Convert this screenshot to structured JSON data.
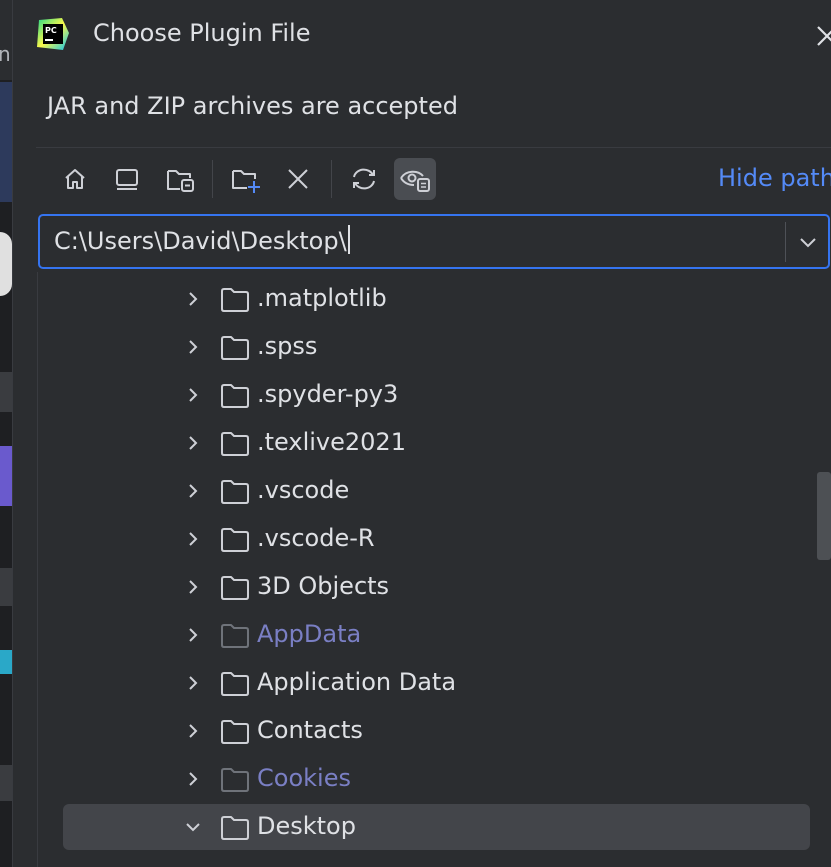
{
  "dialog": {
    "title": "Choose Plugin File",
    "description": "JAR and ZIP archives are accepted",
    "colors": {
      "background": "#2b2d30",
      "accent": "#3574f0",
      "link": "#548af7",
      "hidden_text": "#7a7fc4"
    }
  },
  "toolbar": {
    "buttons": [
      {
        "icon": "home-icon"
      },
      {
        "icon": "desktop-icon"
      },
      {
        "icon": "project-folder-icon"
      },
      {
        "icon": "new-folder-icon"
      },
      {
        "icon": "delete-icon"
      },
      {
        "icon": "refresh-icon"
      },
      {
        "icon": "show-hidden-files-icon",
        "active": true
      }
    ],
    "hide_path_label": "Hide path"
  },
  "path": {
    "value": "C:\\Users\\David\\Desktop\\"
  },
  "tree": {
    "items": [
      {
        "label": ".matplotlib",
        "expanded": false,
        "hidden": false
      },
      {
        "label": ".spss",
        "expanded": false,
        "hidden": false
      },
      {
        "label": ".spyder-py3",
        "expanded": false,
        "hidden": false
      },
      {
        "label": ".texlive2021",
        "expanded": false,
        "hidden": false
      },
      {
        "label": ".vscode",
        "expanded": false,
        "hidden": false
      },
      {
        "label": ".vscode-R",
        "expanded": false,
        "hidden": false
      },
      {
        "label": "3D Objects",
        "expanded": false,
        "hidden": false
      },
      {
        "label": "AppData",
        "expanded": false,
        "hidden": true
      },
      {
        "label": "Application Data",
        "expanded": false,
        "hidden": false
      },
      {
        "label": "Contacts",
        "expanded": false,
        "hidden": false
      },
      {
        "label": "Cookies",
        "expanded": false,
        "hidden": true
      },
      {
        "label": "Desktop",
        "expanded": true,
        "hidden": false,
        "selected": true
      }
    ]
  }
}
